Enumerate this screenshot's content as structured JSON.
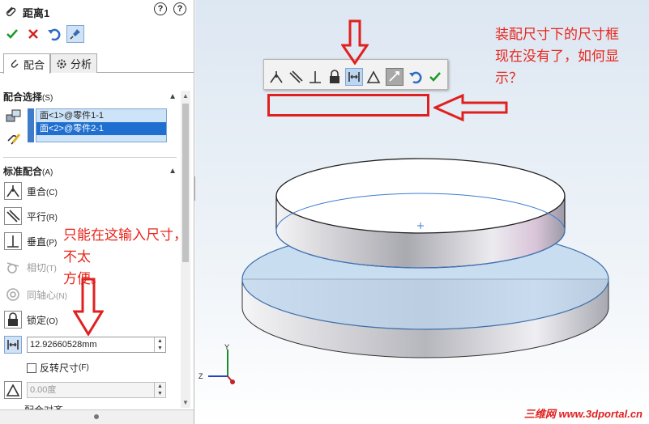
{
  "panel": {
    "title": "距离1",
    "help_primary": "?",
    "help_secondary": "?",
    "tabs": [
      "配合",
      "分析"
    ],
    "selection_section": "配合选择",
    "selection_hint": "(S)",
    "selections": [
      "面<1>@零件1-1",
      "面<2>@零件2-1"
    ],
    "standard_section": "标准配合",
    "standard_hint": "(A)",
    "mates": [
      {
        "label": "重合",
        "key": "(C)"
      },
      {
        "label": "平行",
        "key": "(R)"
      },
      {
        "label": "垂直",
        "key": "(P)"
      },
      {
        "label": "相切",
        "key": "(T)"
      },
      {
        "label": "同轴心",
        "key": "(N)"
      },
      {
        "label": "锁定",
        "key": "(O)"
      }
    ],
    "distance_value": "12.92660528mm",
    "flip_label": "反转尺寸",
    "flip_key": "(F)",
    "angle_placeholder": "0.00度",
    "next_section_partial": "配合对齐"
  },
  "annotations": {
    "top_right": [
      "装配尺寸下的尺寸框",
      "现在没有了，如何显",
      "示？"
    ],
    "left_panel": [
      "只能在这输入尺寸，不太",
      "方便。"
    ]
  },
  "triad": {
    "y": "Y",
    "z": "Z"
  },
  "watermark": "三维网 www.3dportal.cn",
  "colors": {
    "accent": "#1f6fd0",
    "note_red": "#e8261b",
    "selection_bg": "#cde3f8"
  }
}
